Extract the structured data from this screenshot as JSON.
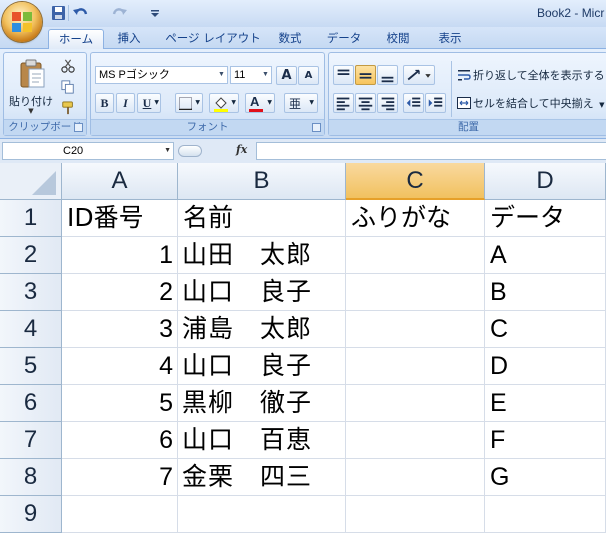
{
  "window": {
    "title": "Book2 - Micr"
  },
  "quick_access": {
    "save_icon": "save-icon",
    "undo_icon": "undo-icon",
    "redo_icon": "redo-icon"
  },
  "tabs": [
    "ホーム",
    "挿入",
    "ページ レイアウト",
    "数式",
    "データ",
    "校閲",
    "表示"
  ],
  "ribbon": {
    "clipboard": {
      "label": "クリップボード",
      "paste_label": "貼り付け"
    },
    "font": {
      "label": "フォント",
      "font_name": "MS Pゴシック",
      "font_size": "11",
      "bold": "B",
      "italic": "I",
      "underline": "U",
      "grow": "A",
      "shrink": "A",
      "phonetic": "亜"
    },
    "alignment": {
      "label": "配置",
      "wrap_text": "折り返して全体を表示する",
      "merge_center": "セルを結合して中央揃え"
    }
  },
  "formula_bar": {
    "name_box": "C20",
    "fx": "fx",
    "formula": ""
  },
  "sheet": {
    "columns": [
      "A",
      "B",
      "C",
      "D"
    ],
    "selected_column": "C",
    "rows": [
      "1",
      "2",
      "3",
      "4",
      "5",
      "6",
      "7",
      "8",
      "9"
    ],
    "cells": [
      [
        "ID番号",
        "名前",
        "ふりがな",
        "データ"
      ],
      [
        "1",
        "山田　太郎",
        "",
        "A"
      ],
      [
        "2",
        "山口　良子",
        "",
        "B"
      ],
      [
        "3",
        "浦島　太郎",
        "",
        "C"
      ],
      [
        "4",
        "山口　良子",
        "",
        "D"
      ],
      [
        "5",
        "黒柳　徹子",
        "",
        "E"
      ],
      [
        "6",
        "山口　百恵",
        "",
        "F"
      ],
      [
        "7",
        "金栗　四三",
        "",
        "G"
      ],
      [
        "",
        "",
        "",
        ""
      ]
    ]
  },
  "colors": {
    "accent": "#15428b",
    "selected_header": "#f1c15f",
    "ribbon_bg": "#dce9f9"
  }
}
